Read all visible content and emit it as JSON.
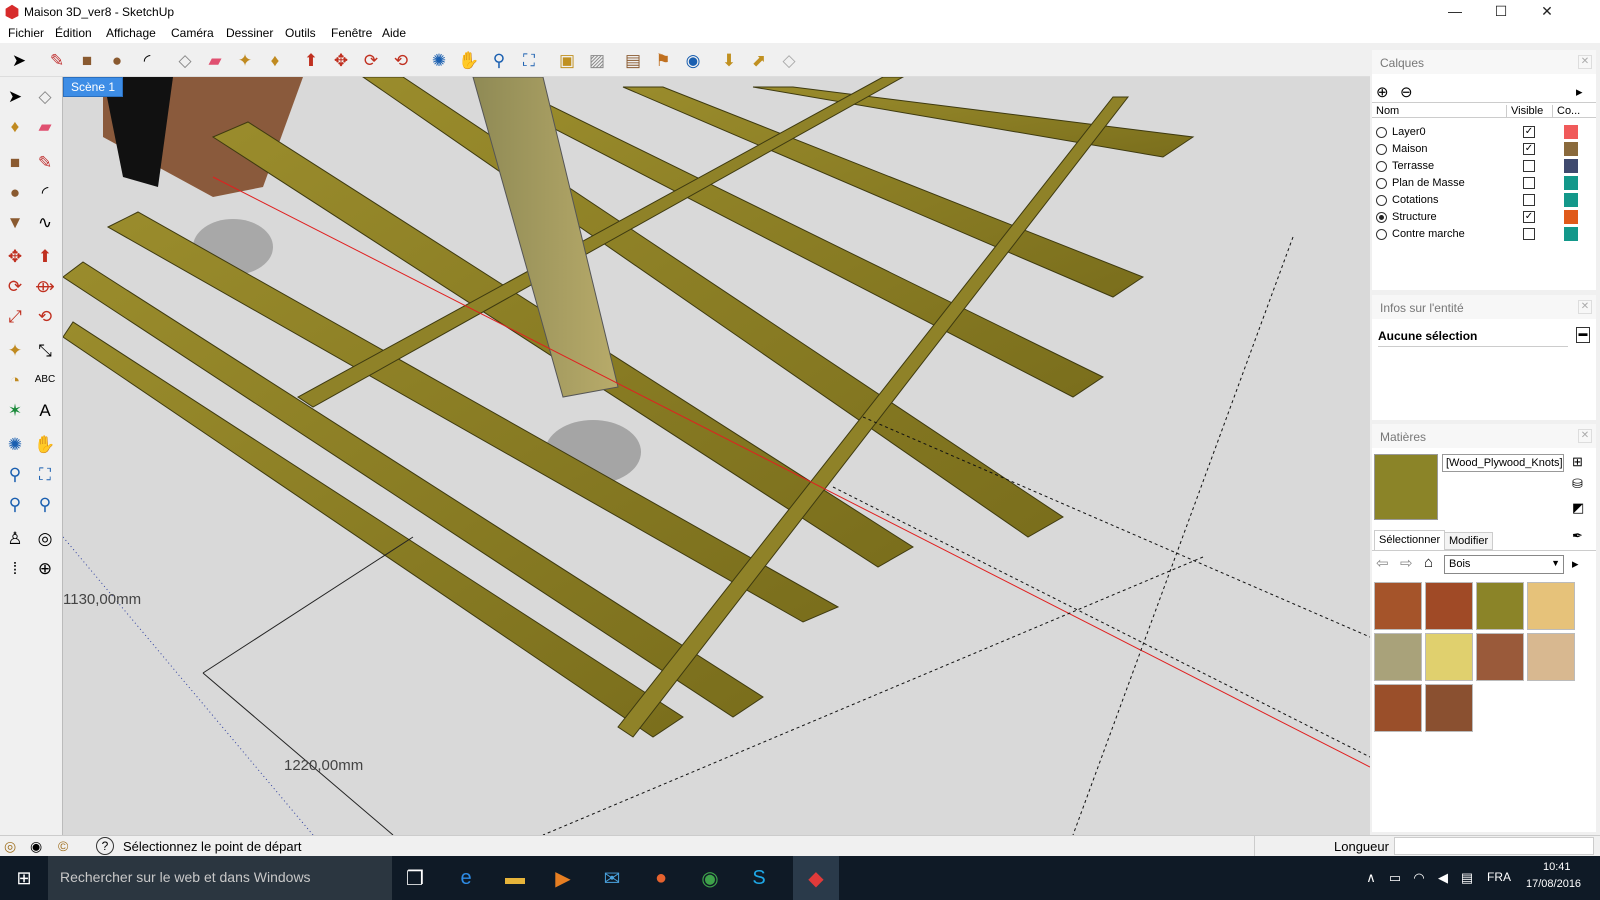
{
  "window": {
    "title": "Maison 3D_ver8 - SketchUp",
    "minimize": "—",
    "maximize": "☐",
    "close": "✕"
  },
  "menu": [
    "Fichier",
    "Édition",
    "Affichage",
    "Caméra",
    "Dessiner",
    "Outils",
    "Fenêtre",
    "Aide"
  ],
  "scene_tab": "Scène 1",
  "dimensions": {
    "vertical": "1130,00mm",
    "horizontal": "1220,00mm"
  },
  "layers": {
    "title": "Calques",
    "columns": {
      "name": "Nom",
      "visible": "Visible",
      "color": "Co..."
    },
    "rows": [
      {
        "name": "Layer0",
        "visible": true,
        "active": false,
        "color": "#f05a5a"
      },
      {
        "name": "Maison",
        "visible": true,
        "active": false,
        "color": "#8a6a3c"
      },
      {
        "name": "Terrasse",
        "visible": false,
        "active": false,
        "color": "#3f4a6e"
      },
      {
        "name": "Plan de Masse",
        "visible": false,
        "active": false,
        "color": "#13988a"
      },
      {
        "name": "Cotations",
        "visible": false,
        "active": false,
        "color": "#13988a"
      },
      {
        "name": "Structure",
        "visible": true,
        "active": true,
        "color": "#e05a1a"
      },
      {
        "name": "Contre marche",
        "visible": false,
        "active": false,
        "color": "#13988a"
      }
    ]
  },
  "entity_info": {
    "title": "Infos sur l'entité",
    "selection": "Aucune sélection"
  },
  "materials": {
    "title": "Matières",
    "current": "[Wood_Plywood_Knots]",
    "tabs": {
      "select": "Sélectionner",
      "edit": "Modifier"
    },
    "library": "Bois",
    "swatches": [
      "#a5542a",
      "#a04a26",
      "#8b8428",
      "#e6c27a",
      "#a9a27a",
      "#e0d06e",
      "#9a5a3a",
      "#d8b890",
      "#9a4f2a",
      "#8a5030"
    ]
  },
  "status": {
    "message": "Sélectionnez le point de départ",
    "measure_label": "Longueur"
  },
  "taskbar": {
    "search": "Rechercher sur le web et dans Windows",
    "language": "FRA",
    "time": "10:41",
    "date": "17/08/2016"
  },
  "colors": {
    "scene_tab": "#3d8de6",
    "wood": "#8a7d22",
    "red_axis": "#e02020"
  }
}
